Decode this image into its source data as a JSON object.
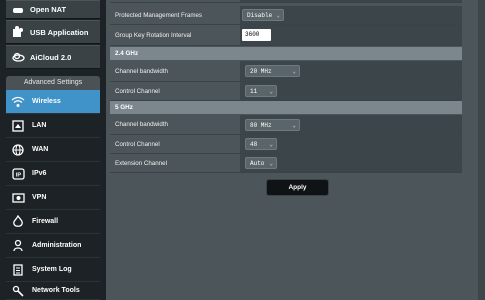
{
  "sidebar": {
    "top_items": [
      {
        "label": "Open NAT",
        "icon": "game-controller-icon"
      },
      {
        "label": "USB Application",
        "icon": "puzzle-icon"
      },
      {
        "label": "AiCloud 2.0",
        "icon": "cloud-icon"
      }
    ],
    "advanced_header": "Advanced Settings",
    "nav_items": [
      {
        "label": "Wireless",
        "icon": "wifi-icon",
        "active": true
      },
      {
        "label": "LAN",
        "icon": "home-icon"
      },
      {
        "label": "WAN",
        "icon": "globe-icon"
      },
      {
        "label": "IPv6",
        "icon": "ipv6-icon"
      },
      {
        "label": "VPN",
        "icon": "vpn-icon"
      },
      {
        "label": "Firewall",
        "icon": "firewall-icon"
      },
      {
        "label": "Administration",
        "icon": "admin-icon"
      },
      {
        "label": "System Log",
        "icon": "log-icon"
      },
      {
        "label": "Network Tools",
        "icon": "tools-icon"
      }
    ]
  },
  "general": {
    "pmf_label": "Protected Management Frames",
    "pmf_value": "Disable",
    "gkri_label": "Group Key Rotation Interval",
    "gkri_value": "3600"
  },
  "band_24": {
    "title": "2.4 GHz",
    "bandwidth_label": "Channel bandwidth",
    "bandwidth_value": "20 MHz",
    "control_label": "Control Channel",
    "control_value": "11"
  },
  "band_5": {
    "title": "5 GHz",
    "bandwidth_label": "Channel bandwidth",
    "bandwidth_value": "80 MHz",
    "control_label": "Control Channel",
    "control_value": "48",
    "extension_label": "Extension Channel",
    "extension_value": "Auto"
  },
  "apply_label": "Apply",
  "colors": {
    "accent": "#3f93c9",
    "highlight": "#f0e800"
  }
}
